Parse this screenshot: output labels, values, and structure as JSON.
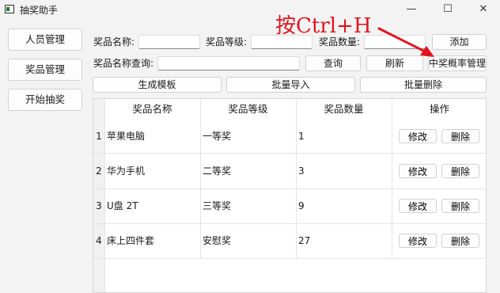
{
  "window": {
    "title": "抽奖助手",
    "minimize": "—",
    "maximize": "☐",
    "close": "✕"
  },
  "sidebar": {
    "items": [
      {
        "label": "人员管理"
      },
      {
        "label": "奖品管理"
      },
      {
        "label": "开始抽奖"
      }
    ]
  },
  "form": {
    "name_label": "奖品名称:",
    "level_label": "奖品等级:",
    "qty_label": "奖品数量:",
    "add_button": "添加",
    "query_label": "奖品名称查询:",
    "query_button": "查询",
    "refresh_button": "刷新",
    "prob_button": "中奖概率管理",
    "template_button": "生成模板",
    "import_button": "批量导入",
    "delete_button": "批量删除"
  },
  "annotation": {
    "text": "按Ctrl+H",
    "color": "#e0141e"
  },
  "table": {
    "columns": [
      "奖品名称",
      "奖品等级",
      "奖品数量",
      "操作"
    ],
    "edit_label": "修改",
    "delete_label": "删除",
    "rows": [
      {
        "num": "1",
        "name": "苹果电脑",
        "level": "一等奖",
        "qty": "1"
      },
      {
        "num": "2",
        "name": "华为手机",
        "level": "二等奖",
        "qty": "3"
      },
      {
        "num": "3",
        "name": "U盘 2T",
        "level": "三等奖",
        "qty": "9"
      },
      {
        "num": "4",
        "name": "床上四件套",
        "level": "安慰奖",
        "qty": "27"
      }
    ]
  }
}
